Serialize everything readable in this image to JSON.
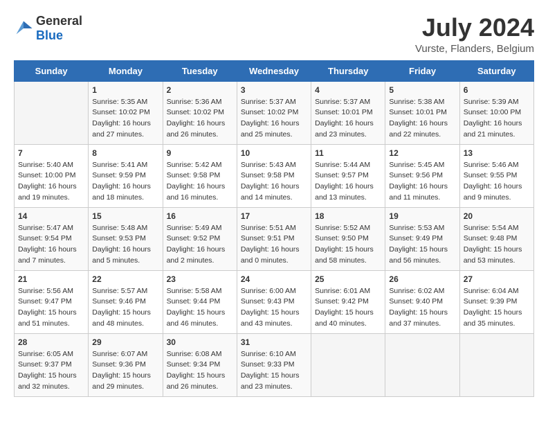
{
  "logo": {
    "general": "General",
    "blue": "Blue"
  },
  "title": {
    "month_year": "July 2024",
    "location": "Vurste, Flanders, Belgium"
  },
  "headers": [
    "Sunday",
    "Monday",
    "Tuesday",
    "Wednesday",
    "Thursday",
    "Friday",
    "Saturday"
  ],
  "weeks": [
    [
      {
        "day": "",
        "info": ""
      },
      {
        "day": "1",
        "info": "Sunrise: 5:35 AM\nSunset: 10:02 PM\nDaylight: 16 hours\nand 27 minutes."
      },
      {
        "day": "2",
        "info": "Sunrise: 5:36 AM\nSunset: 10:02 PM\nDaylight: 16 hours\nand 26 minutes."
      },
      {
        "day": "3",
        "info": "Sunrise: 5:37 AM\nSunset: 10:02 PM\nDaylight: 16 hours\nand 25 minutes."
      },
      {
        "day": "4",
        "info": "Sunrise: 5:37 AM\nSunset: 10:01 PM\nDaylight: 16 hours\nand 23 minutes."
      },
      {
        "day": "5",
        "info": "Sunrise: 5:38 AM\nSunset: 10:01 PM\nDaylight: 16 hours\nand 22 minutes."
      },
      {
        "day": "6",
        "info": "Sunrise: 5:39 AM\nSunset: 10:00 PM\nDaylight: 16 hours\nand 21 minutes."
      }
    ],
    [
      {
        "day": "7",
        "info": "Sunrise: 5:40 AM\nSunset: 10:00 PM\nDaylight: 16 hours\nand 19 minutes."
      },
      {
        "day": "8",
        "info": "Sunrise: 5:41 AM\nSunset: 9:59 PM\nDaylight: 16 hours\nand 18 minutes."
      },
      {
        "day": "9",
        "info": "Sunrise: 5:42 AM\nSunset: 9:58 PM\nDaylight: 16 hours\nand 16 minutes."
      },
      {
        "day": "10",
        "info": "Sunrise: 5:43 AM\nSunset: 9:58 PM\nDaylight: 16 hours\nand 14 minutes."
      },
      {
        "day": "11",
        "info": "Sunrise: 5:44 AM\nSunset: 9:57 PM\nDaylight: 16 hours\nand 13 minutes."
      },
      {
        "day": "12",
        "info": "Sunrise: 5:45 AM\nSunset: 9:56 PM\nDaylight: 16 hours\nand 11 minutes."
      },
      {
        "day": "13",
        "info": "Sunrise: 5:46 AM\nSunset: 9:55 PM\nDaylight: 16 hours\nand 9 minutes."
      }
    ],
    [
      {
        "day": "14",
        "info": "Sunrise: 5:47 AM\nSunset: 9:54 PM\nDaylight: 16 hours\nand 7 minutes."
      },
      {
        "day": "15",
        "info": "Sunrise: 5:48 AM\nSunset: 9:53 PM\nDaylight: 16 hours\nand 5 minutes."
      },
      {
        "day": "16",
        "info": "Sunrise: 5:49 AM\nSunset: 9:52 PM\nDaylight: 16 hours\nand 2 minutes."
      },
      {
        "day": "17",
        "info": "Sunrise: 5:51 AM\nSunset: 9:51 PM\nDaylight: 16 hours\nand 0 minutes."
      },
      {
        "day": "18",
        "info": "Sunrise: 5:52 AM\nSunset: 9:50 PM\nDaylight: 15 hours\nand 58 minutes."
      },
      {
        "day": "19",
        "info": "Sunrise: 5:53 AM\nSunset: 9:49 PM\nDaylight: 15 hours\nand 56 minutes."
      },
      {
        "day": "20",
        "info": "Sunrise: 5:54 AM\nSunset: 9:48 PM\nDaylight: 15 hours\nand 53 minutes."
      }
    ],
    [
      {
        "day": "21",
        "info": "Sunrise: 5:56 AM\nSunset: 9:47 PM\nDaylight: 15 hours\nand 51 minutes."
      },
      {
        "day": "22",
        "info": "Sunrise: 5:57 AM\nSunset: 9:46 PM\nDaylight: 15 hours\nand 48 minutes."
      },
      {
        "day": "23",
        "info": "Sunrise: 5:58 AM\nSunset: 9:44 PM\nDaylight: 15 hours\nand 46 minutes."
      },
      {
        "day": "24",
        "info": "Sunrise: 6:00 AM\nSunset: 9:43 PM\nDaylight: 15 hours\nand 43 minutes."
      },
      {
        "day": "25",
        "info": "Sunrise: 6:01 AM\nSunset: 9:42 PM\nDaylight: 15 hours\nand 40 minutes."
      },
      {
        "day": "26",
        "info": "Sunrise: 6:02 AM\nSunset: 9:40 PM\nDaylight: 15 hours\nand 37 minutes."
      },
      {
        "day": "27",
        "info": "Sunrise: 6:04 AM\nSunset: 9:39 PM\nDaylight: 15 hours\nand 35 minutes."
      }
    ],
    [
      {
        "day": "28",
        "info": "Sunrise: 6:05 AM\nSunset: 9:37 PM\nDaylight: 15 hours\nand 32 minutes."
      },
      {
        "day": "29",
        "info": "Sunrise: 6:07 AM\nSunset: 9:36 PM\nDaylight: 15 hours\nand 29 minutes."
      },
      {
        "day": "30",
        "info": "Sunrise: 6:08 AM\nSunset: 9:34 PM\nDaylight: 15 hours\nand 26 minutes."
      },
      {
        "day": "31",
        "info": "Sunrise: 6:10 AM\nSunset: 9:33 PM\nDaylight: 15 hours\nand 23 minutes."
      },
      {
        "day": "",
        "info": ""
      },
      {
        "day": "",
        "info": ""
      },
      {
        "day": "",
        "info": ""
      }
    ]
  ]
}
